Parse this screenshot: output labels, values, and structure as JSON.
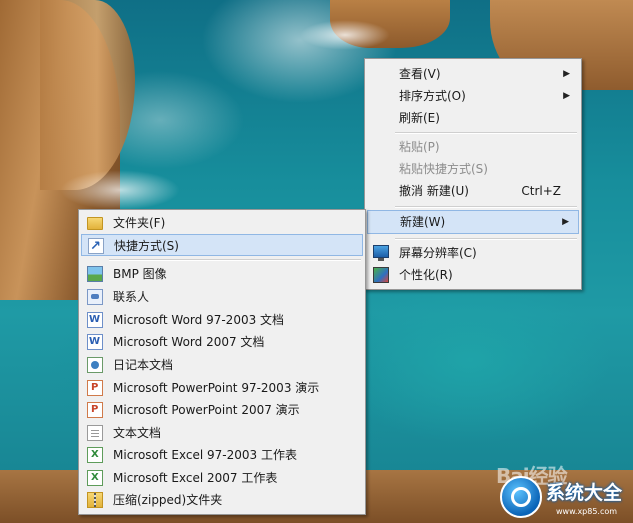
{
  "main_menu": {
    "items": [
      {
        "label": "查看(V)",
        "submenu": true
      },
      {
        "label": "排序方式(O)",
        "submenu": true
      },
      {
        "label": "刷新(E)"
      },
      {
        "label": "粘贴(P)",
        "disabled": true
      },
      {
        "label": "粘贴快捷方式(S)",
        "disabled": true
      },
      {
        "label": "撤消 新建(U)",
        "shortcut": "Ctrl+Z"
      },
      {
        "label": "新建(W)",
        "submenu": true,
        "highlighted": true
      },
      {
        "label": "屏幕分辨率(C)",
        "icon": "screen-resolution-icon"
      },
      {
        "label": "个性化(R)",
        "icon": "personalize-icon"
      }
    ]
  },
  "new_submenu": {
    "items": [
      {
        "label": "文件夹(F)",
        "icon": "folder-icon"
      },
      {
        "label": "快捷方式(S)",
        "icon": "shortcut-icon",
        "highlighted": true
      },
      {
        "label": "BMP 图像",
        "icon": "bitmap-image-icon"
      },
      {
        "label": "联系人",
        "icon": "contact-icon"
      },
      {
        "label": "Microsoft Word 97-2003 文档",
        "icon": "word-document-icon"
      },
      {
        "label": "Microsoft Word 2007 文档",
        "icon": "word-document-icon"
      },
      {
        "label": "日记本文档",
        "icon": "journal-document-icon"
      },
      {
        "label": "Microsoft PowerPoint 97-2003 演示",
        "icon": "powerpoint-icon"
      },
      {
        "label": "Microsoft PowerPoint 2007 演示",
        "icon": "powerpoint-icon"
      },
      {
        "label": "文本文档",
        "icon": "text-document-icon"
      },
      {
        "label": "Microsoft Excel 97-2003 工作表",
        "icon": "excel-icon"
      },
      {
        "label": "Microsoft Excel 2007 工作表",
        "icon": "excel-icon"
      },
      {
        "label": "压缩(zipped)文件夹",
        "icon": "zip-folder-icon"
      }
    ]
  },
  "watermarks": {
    "baidu": "Bai经验",
    "site_name": "系统大全",
    "site_url": "www.xp85.com"
  },
  "colors": {
    "menu_background": "#f0f0f0",
    "highlight_fill": "#d4e4f7",
    "highlight_border": "#90b7e4",
    "disabled_text": "#8d8d8d"
  }
}
